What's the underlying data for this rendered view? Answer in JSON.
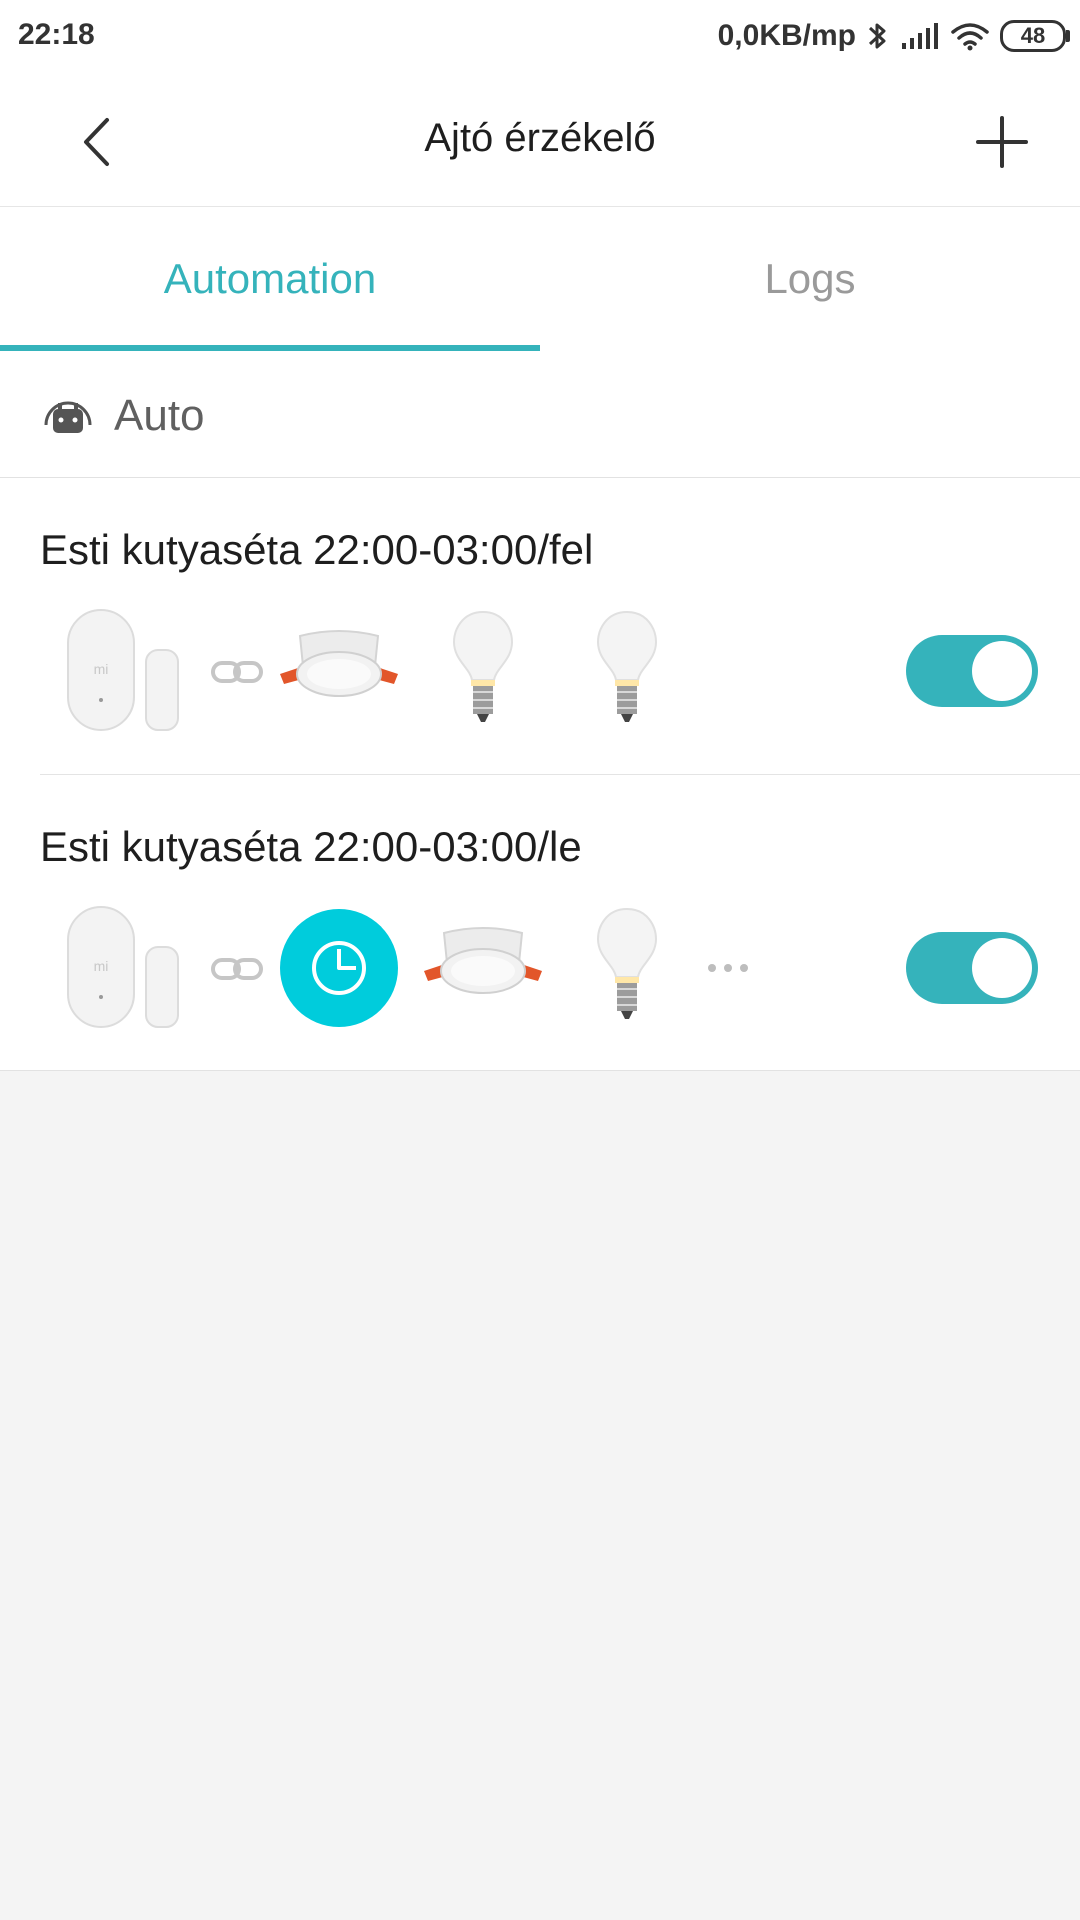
{
  "status_bar": {
    "time": "22:18",
    "speed": "0,0KB/mp",
    "battery": "48"
  },
  "header": {
    "title": "Ajtó érzékelő"
  },
  "tabs": [
    {
      "label": "Automation",
      "selected": true
    },
    {
      "label": "Logs",
      "selected": false
    }
  ],
  "section": {
    "label": "Auto"
  },
  "automations": [
    {
      "title": "Esti kutyaséta 22:00-03:00/fel",
      "enabled": true,
      "icons": [
        "door-sensor-icon",
        "link-icon",
        "ceiling-light-icon",
        "light-bulb-icon",
        "light-bulb-icon"
      ]
    },
    {
      "title": "Esti kutyaséta 22:00-03:00/le",
      "enabled": true,
      "icons": [
        "door-sensor-icon",
        "link-icon",
        "timer-icon",
        "ceiling-light-icon",
        "light-bulb-icon",
        "more-icon"
      ]
    }
  ],
  "colors": {
    "accent": "#35b3bb",
    "timer": "#00ccdc",
    "background": "#f4f4f4"
  }
}
